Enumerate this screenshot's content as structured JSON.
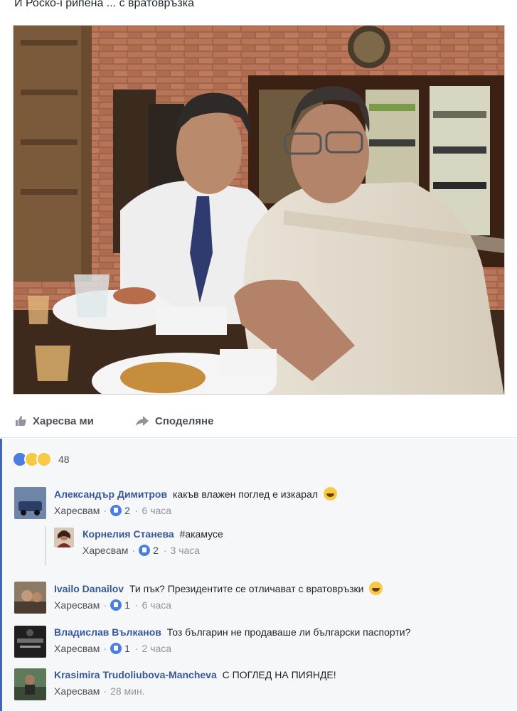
{
  "post": {
    "caption": "И Роско-і рипена ... с вратовръзка"
  },
  "actions": {
    "like_label": "Харесва ми",
    "share_label": "Споделяне"
  },
  "reactions": {
    "icons": [
      "like-icon",
      "haha-icon",
      "wow-icon"
    ],
    "count": "48"
  },
  "comments": [
    {
      "author": "Александър Димитров",
      "text": "какъв влажен поглед е изкарал",
      "has_emoji": true,
      "like_label": "Харесвам",
      "likes": "2",
      "time": "6 часа",
      "replies": [
        {
          "author": "Корнелия Станева",
          "text": "#акамусе",
          "like_label": "Харесвам",
          "likes": "2",
          "time": "3 часа"
        }
      ]
    },
    {
      "author": "Ivailo Danailov",
      "text": "Ти пък? Президентите се отличават с вратовръзки",
      "has_emoji": true,
      "like_label": "Харесвам",
      "likes": "1",
      "time": "6 часа"
    },
    {
      "author": "Владислав Вълканов",
      "text": "Тоз българин не продаваше ли български паспорти?",
      "like_label": "Харесвам",
      "likes": "1",
      "time": "2 часа"
    },
    {
      "author": "Krasimira Trudoliubova-Mancheva",
      "text": "С ПОГЛЕД НА ПИЯНДЕ!",
      "like_label": "Харесвам",
      "time": "28 мин."
    }
  ],
  "colors": {
    "accent": "#4267b2",
    "author": "#365899",
    "meta": "#90949c"
  }
}
